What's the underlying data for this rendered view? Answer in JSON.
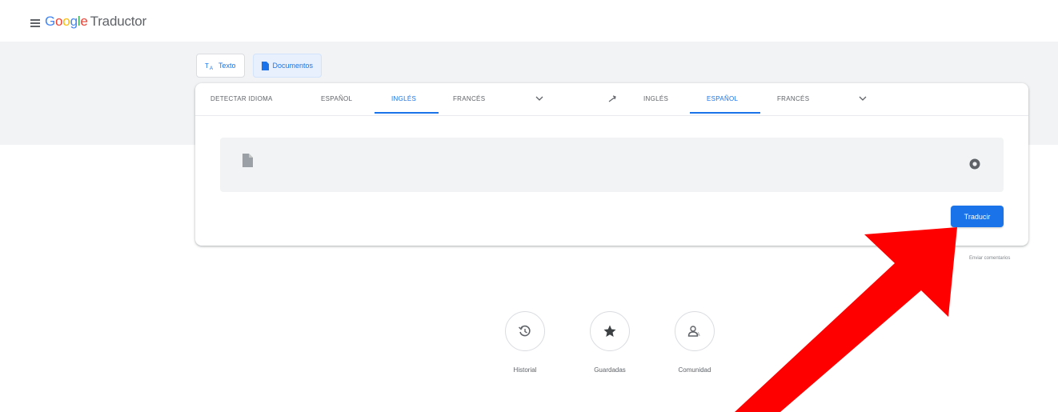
{
  "header": {
    "logo_product": "Traductor"
  },
  "mode_tabs": [
    {
      "label": "Texto",
      "icon": "text-translate-icon",
      "active": false
    },
    {
      "label": "Documentos",
      "icon": "document-icon",
      "active": true
    }
  ],
  "source_languages": [
    {
      "label": "DETECTAR IDIOMA",
      "active": false
    },
    {
      "label": "ESPAÑOL",
      "active": false
    },
    {
      "label": "INGLÉS",
      "active": true
    },
    {
      "label": "FRANCÉS",
      "active": false
    }
  ],
  "target_languages": [
    {
      "label": "INGLÉS",
      "active": false
    },
    {
      "label": "ESPAÑOL",
      "active": true
    },
    {
      "label": "FRANCÉS",
      "active": false
    }
  ],
  "document_area": {
    "file_icon": "document-icon",
    "close_icon": "close-circle-icon"
  },
  "translate_button": "Traducir",
  "feedback_link": "Enviar comentarios",
  "bottom_actions": [
    {
      "label": "Historial",
      "icon": "history-icon"
    },
    {
      "label": "Guardadas",
      "icon": "star-icon"
    },
    {
      "label": "Comunidad",
      "icon": "community-icon"
    }
  ],
  "colors": {
    "accent": "#1a73e8",
    "annotation_arrow": "#ff0000",
    "band": "#f1f3f4"
  }
}
